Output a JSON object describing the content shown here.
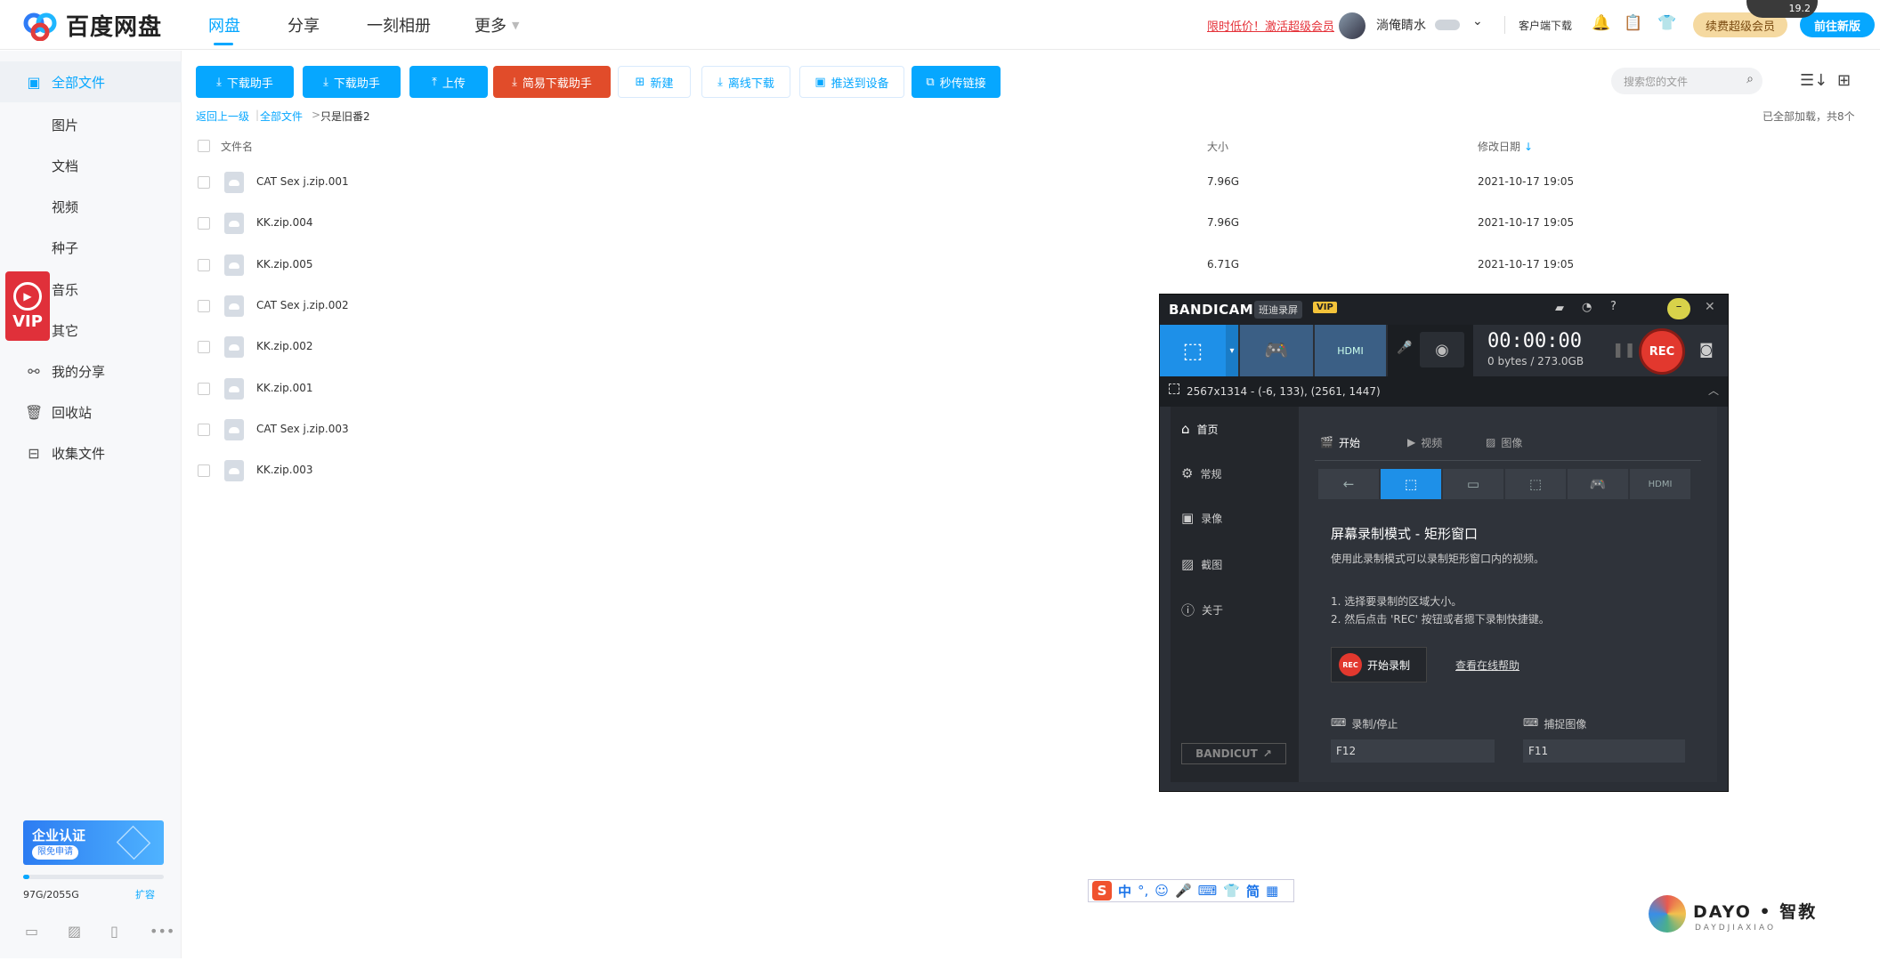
{
  "app": {
    "name": "百度网盘"
  },
  "nav": [
    {
      "label": "网盘"
    },
    {
      "label": "分享"
    },
    {
      "label": "一刻相册"
    },
    {
      "label": "更多"
    }
  ],
  "header": {
    "promo": "限时低价！激活超级会员",
    "username": "淌俺睛水",
    "client_download": "客户端下载",
    "renew": "续费超级会员",
    "new_version": "前往新版",
    "speed": "19.2"
  },
  "sidebar": {
    "all_files": "全部文件",
    "sub": [
      "图片",
      "文档",
      "视频",
      "种子",
      "音乐",
      "其它"
    ],
    "vip": "VIP",
    "my_share": "我的分享",
    "recycle": "回收站",
    "collect": "收集文件",
    "enterprise": "企业认证",
    "enterprise_sub": "限免申请",
    "storage": "97G/2055G",
    "expand": "扩容",
    "storage_fraction": 0.047
  },
  "toolbar": {
    "dl1": "下载助手",
    "dl2": "下载助手",
    "upload": "上传",
    "easy_dl": "简易下载助手",
    "new": "新建",
    "offline": "离线下载",
    "push": "推送到设备",
    "quick_link": "秒传链接"
  },
  "search": {
    "placeholder": "搜索您的文件"
  },
  "breadcrumb": {
    "back": "返回上一级",
    "sep": "|",
    "all": "全部文件",
    "arrow": ">",
    "current": "只是旧番2"
  },
  "loaded": "已全部加载，共8个",
  "columns": {
    "name": "文件名",
    "size": "大小",
    "date": "修改日期"
  },
  "files": [
    {
      "name": "CAT Sex j.zip.001",
      "size": "7.96G",
      "date": "2021-10-17 19:05"
    },
    {
      "name": "KK.zip.004",
      "size": "7.96G",
      "date": "2021-10-17 19:05"
    },
    {
      "name": "KK.zip.005",
      "size": "6.71G",
      "date": "2021-10-17 19:05"
    },
    {
      "name": "CAT Sex j.zip.002",
      "size": "",
      "date": ""
    },
    {
      "name": "KK.zip.002",
      "size": "",
      "date": ""
    },
    {
      "name": "KK.zip.001",
      "size": "",
      "date": ""
    },
    {
      "name": "CAT Sex j.zip.003",
      "size": "",
      "date": ""
    },
    {
      "name": "KK.zip.003",
      "size": "",
      "date": ""
    }
  ],
  "bandicam": {
    "brand": "BANDICAM",
    "brand_cn": "班迪录屏",
    "vip": "VIP",
    "time": "00:00:00",
    "bytes": "0 bytes / 273.0GB",
    "rec": "REC",
    "rect": "2567x1314 - (-6, 133), (2561, 1447)",
    "menu": [
      "首页",
      "常规",
      "录像",
      "截图",
      "关于"
    ],
    "tabs": [
      "开始",
      "视频",
      "图像"
    ],
    "mode_title": "屏幕录制模式 - 矩形窗口",
    "mode_desc": "使用此录制模式可以录制矩形窗口内的视频。",
    "step1": "1. 选择要录制的区域大小。",
    "step2": "2. 然后点击 'REC' 按钮或者摁下录制快捷键。",
    "start": "开始录制",
    "help": "查看在线帮助",
    "hk_rec_label": "录制/停止",
    "hk_rec": "F12",
    "hk_cap_label": "捕捉图像",
    "hk_cap": "F11",
    "bandicut": "BANDICUT"
  },
  "ime": {
    "s": "S",
    "zh": "中",
    "jian": "简"
  },
  "watermark": {
    "title": "DAYO • 智教",
    "sub": "DAYDJIAXIAO"
  }
}
